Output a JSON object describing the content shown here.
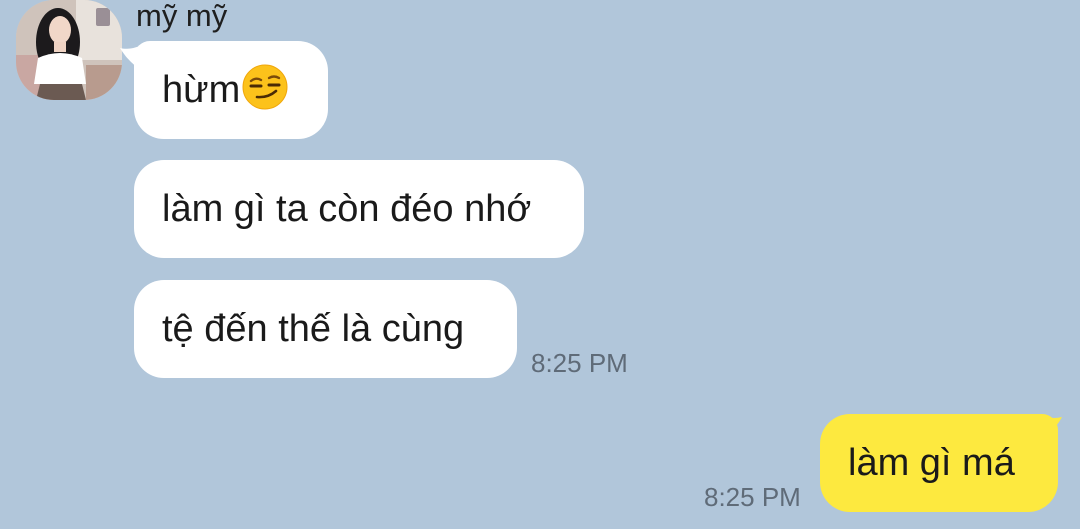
{
  "chat": {
    "sender_name": "mỹ mỹ",
    "avatar_icon": "avatar-photo",
    "incoming": [
      {
        "text": "hừm",
        "emoji": "smirking-face-emoji"
      },
      {
        "text": "làm gì ta còn đéo nhớ"
      },
      {
        "text": "tệ đến thế là cùng",
        "time": "8:25 PM"
      }
    ],
    "outgoing": [
      {
        "text": "làm gì má",
        "time": "8:25 PM"
      }
    ]
  },
  "colors": {
    "background": "#b1c6da",
    "incoming_bubble": "#ffffff",
    "outgoing_bubble": "#fde93f",
    "timestamp": "#5f6b78"
  }
}
